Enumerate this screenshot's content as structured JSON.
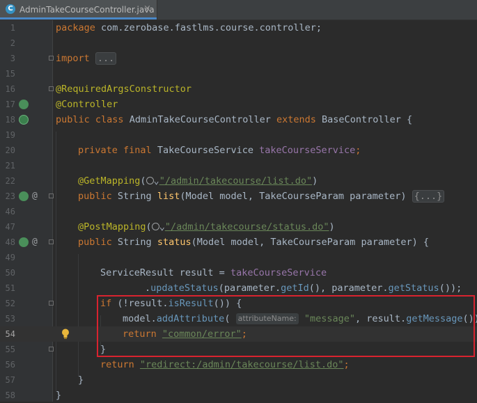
{
  "tab": {
    "title": "AdminTakeCourseController.java",
    "icon": "C",
    "close": "×"
  },
  "lines": [
    {
      "num": "1",
      "text": "package com.zerobase.fastlms.course.controller;"
    },
    {
      "num": "2",
      "text": ""
    },
    {
      "num": "3",
      "text": "import ..."
    },
    {
      "num": "15",
      "text": ""
    },
    {
      "num": "16",
      "text": "@RequiredArgsConstructor"
    },
    {
      "num": "17",
      "text": "@Controller"
    },
    {
      "num": "18",
      "text": "public class AdminTakeCourseController extends BaseController {"
    },
    {
      "num": "19",
      "text": ""
    },
    {
      "num": "20",
      "text": "private final TakeCourseService takeCourseService;"
    },
    {
      "num": "21",
      "text": ""
    },
    {
      "num": "22",
      "text": "@GetMapping(\"/admin/takecourse/list.do\")"
    },
    {
      "num": "23",
      "text": "public String list(Model model, TakeCourseParam parameter) {...}"
    },
    {
      "num": "46",
      "text": ""
    },
    {
      "num": "47",
      "text": "@PostMapping(\"/admin/takecourse/status.do\")"
    },
    {
      "num": "48",
      "text": "public String status(Model model, TakeCourseParam parameter) {"
    },
    {
      "num": "49",
      "text": ""
    },
    {
      "num": "50",
      "text": "ServiceResult result = takeCourseService"
    },
    {
      "num": "51",
      "text": ".updateStatus(parameter.getId(), parameter.getStatus());"
    },
    {
      "num": "52",
      "text": "if (!result.isResult()) {"
    },
    {
      "num": "53",
      "text": "model.addAttribute( attributeName: \"message\", result.getMessage());"
    },
    {
      "num": "54",
      "text": "return \"common/error\";"
    },
    {
      "num": "55",
      "text": "}"
    },
    {
      "num": "56",
      "text": "return \"redirect:/admin/takecourse/list.do\";"
    },
    {
      "num": "57",
      "text": "}"
    },
    {
      "num": "58",
      "text": "}"
    }
  ],
  "tokens": {
    "package": "package",
    "pkg_name": " com.zerobase.fastlms.course.controller;",
    "import": "import",
    "import_fold": "...",
    "ann_rac": "@RequiredArgsConstructor",
    "ann_controller": "@Controller",
    "public": "public",
    "class": "class",
    "class_name": " AdminTakeCourseController ",
    "extends": "extends",
    "base": " BaseController {",
    "private": "private",
    "final": "final",
    "svc_type": " TakeCourseService ",
    "svc_field": "takeCourseService",
    "semi": ";",
    "get_mapping": "@GetMapping",
    "open_paren": "(",
    "globe_chevron": "⌄",
    "list_path": "\"/admin/takecourse/list.do\"",
    "close_paren": ")",
    "string_type": " String ",
    "list_fn": "list",
    "params": "(Model model, TakeCourseParam ",
    "param_name": "parameter",
    "params_end": ") ",
    "body_fold": "{...}",
    "post_mapping": "@PostMapping",
    "status_path": "\"/admin/takecourse/status.do\"",
    "status_fn": "status",
    "params_end_open": ") {",
    "svc_result": "ServiceResult result = ",
    "update_status": "updateStatus",
    "get_id": "getId",
    "get_status": "getStatus",
    "if": "if",
    "is_result": "isResult",
    "model_": "model.",
    "add_attribute": "addAttribute",
    "hint_attr": "attributeName:",
    "message_str": "\"message\"",
    "result_dot": ", result.",
    "get_message": "getMessage",
    "return": "return",
    "error_str": "\"common/error\"",
    "redirect_str": "\"redirect:/admin/takecourse/list.do\"",
    "close_brace": "}",
    "at_sign": "@"
  },
  "colors": {
    "background": "#2b2b2b",
    "keyword": "#cc7832",
    "annotation": "#bbb529",
    "function": "#ffc66d",
    "field": "#9876aa",
    "string": "#6a8759",
    "highlight_box": "#d9232f"
  }
}
